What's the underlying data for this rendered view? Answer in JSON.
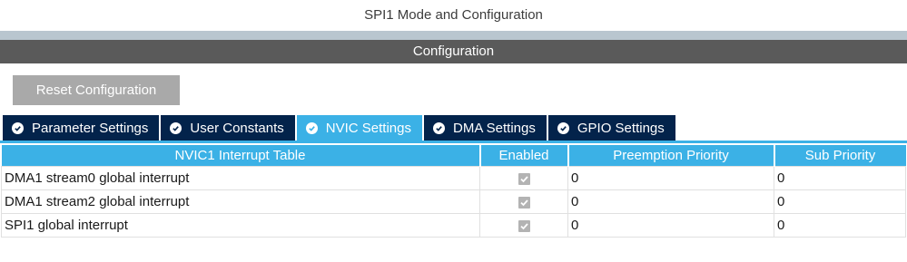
{
  "window": {
    "title": "SPI1 Mode and Configuration"
  },
  "config_header": "Configuration",
  "reset_button": "Reset Configuration",
  "tabs": [
    {
      "label": "Parameter Settings",
      "active": false
    },
    {
      "label": "User Constants",
      "active": false
    },
    {
      "label": "NVIC Settings",
      "active": true
    },
    {
      "label": "DMA Settings",
      "active": false
    },
    {
      "label": "GPIO Settings",
      "active": false
    }
  ],
  "table": {
    "headers": [
      "NVIC1 Interrupt Table",
      "Enabled",
      "Preemption Priority",
      "Sub Priority"
    ],
    "rows": [
      {
        "name": "DMA1 stream0 global interrupt",
        "enabled": true,
        "preemption": "0",
        "sub": "0"
      },
      {
        "name": "DMA1 stream2 global interrupt",
        "enabled": true,
        "preemption": "0",
        "sub": "0"
      },
      {
        "name": "SPI1 global interrupt",
        "enabled": true,
        "preemption": "0",
        "sub": "0"
      }
    ]
  },
  "colors": {
    "tab_bg": "#03234b",
    "tab_active": "#3bb1e6",
    "header_bg": "#3bb1e6",
    "config_bar": "#5a5a5a",
    "button_bg": "#a9a9a9"
  },
  "icons": {
    "tab_icon": "check-circle-icon",
    "enabled_icon": "checkbox-checked-icon"
  }
}
